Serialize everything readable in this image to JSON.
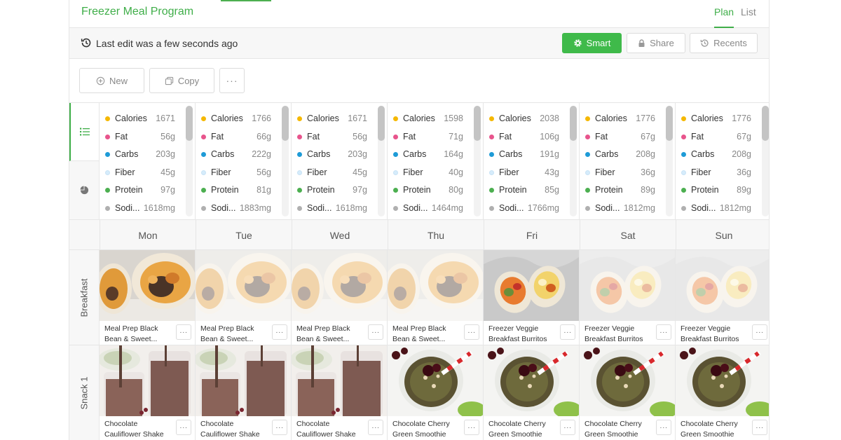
{
  "app": {
    "title": "Freezer Meal Program"
  },
  "view_tabs": {
    "plan": "Plan",
    "list": "List"
  },
  "edit_bar": {
    "last_edit": "Last edit was a few seconds ago",
    "smart_label": "Smart",
    "share_label": "Share",
    "recents_label": "Recents"
  },
  "toolbar": {
    "new_label": "New",
    "copy_label": "Copy",
    "more_label": "···"
  },
  "colors": {
    "accent": "#3fae49",
    "calories": "#f5b800",
    "fat": "#e8548c",
    "carbs": "#1e9bd7",
    "fiber": "#d6ecfb",
    "protein": "#4caf50",
    "sodium": "#b0b0b0"
  },
  "nutrients": [
    "Calories",
    "Fat",
    "Carbs",
    "Fiber",
    "Protein",
    "Sodi..."
  ],
  "nutrient_colors": [
    "calories",
    "fat",
    "carbs",
    "fiber",
    "protein",
    "sodium"
  ],
  "days": [
    {
      "name": "Mon",
      "values": [
        "1671",
        "56g",
        "203g",
        "45g",
        "97g",
        "1618mg"
      ]
    },
    {
      "name": "Tue",
      "values": [
        "1766",
        "66g",
        "222g",
        "56g",
        "81g",
        "1883mg"
      ]
    },
    {
      "name": "Wed",
      "values": [
        "1671",
        "56g",
        "203g",
        "45g",
        "97g",
        "1618mg"
      ]
    },
    {
      "name": "Thu",
      "values": [
        "1598",
        "71g",
        "164g",
        "40g",
        "80g",
        "1464mg"
      ]
    },
    {
      "name": "Fri",
      "values": [
        "2038",
        "106g",
        "191g",
        "43g",
        "85g",
        "1766mg"
      ]
    },
    {
      "name": "Sat",
      "values": [
        "1776",
        "67g",
        "208g",
        "36g",
        "89g",
        "1812mg"
      ]
    },
    {
      "name": "Sun",
      "values": [
        "1776",
        "67g",
        "208g",
        "36g",
        "89g",
        "1812mg"
      ]
    }
  ],
  "meals": [
    {
      "label": "Breakfast",
      "cells": [
        {
          "name": "Meal Prep Black Bean & Sweet...",
          "image": "burrito-sweet-potato",
          "faded": false
        },
        {
          "name": "Meal Prep Black Bean & Sweet...",
          "image": "burrito-sweet-potato",
          "faded": true
        },
        {
          "name": "Meal Prep Black Bean & Sweet...",
          "image": "burrito-sweet-potato",
          "faded": true
        },
        {
          "name": "Meal Prep Black Bean & Sweet...",
          "image": "burrito-sweet-potato",
          "faded": true
        },
        {
          "name": "Freezer Veggie Breakfast Burritos",
          "image": "veggie-burrito",
          "faded": false
        },
        {
          "name": "Freezer Veggie Breakfast Burritos",
          "image": "veggie-burrito",
          "faded": true
        },
        {
          "name": "Freezer Veggie Breakfast Burritos",
          "image": "veggie-burrito",
          "faded": true
        }
      ]
    },
    {
      "label": "Snack 1",
      "cells": [
        {
          "name": "Chocolate Cauliflower Shake",
          "image": "chocolate-shake",
          "faded": false
        },
        {
          "name": "Chocolate Cauliflower Shake",
          "image": "chocolate-shake",
          "faded": false
        },
        {
          "name": "Chocolate Cauliflower Shake",
          "image": "chocolate-shake",
          "faded": false
        },
        {
          "name": "Chocolate Cherry Green Smoothie",
          "image": "green-smoothie",
          "faded": false
        },
        {
          "name": "Chocolate Cherry Green Smoothie",
          "image": "green-smoothie",
          "faded": false
        },
        {
          "name": "Chocolate Cherry Green Smoothie",
          "image": "green-smoothie",
          "faded": false
        },
        {
          "name": "Chocolate Cherry Green Smoothie",
          "image": "green-smoothie",
          "faded": false
        }
      ]
    }
  ],
  "cell_more_label": "···"
}
